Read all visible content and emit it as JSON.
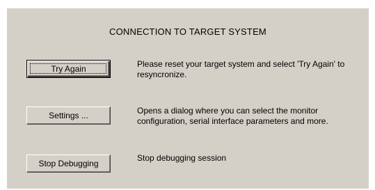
{
  "dialog": {
    "title": "CONNECTION TO TARGET SYSTEM"
  },
  "actions": [
    {
      "button_label": "Try Again",
      "description": "Please reset your target system and select 'Try Again' to resyncronize.",
      "is_default": true
    },
    {
      "button_label": "Settings ...",
      "description": "Opens a dialog where you can select the monitor configuration, serial interface parameters and more.",
      "is_default": false
    },
    {
      "button_label": "Stop Debugging",
      "description": "Stop debugging session",
      "is_default": false
    }
  ],
  "colors": {
    "dialog_background": "#d4d0c8",
    "page_background": "#ffffff",
    "text": "#000000"
  }
}
